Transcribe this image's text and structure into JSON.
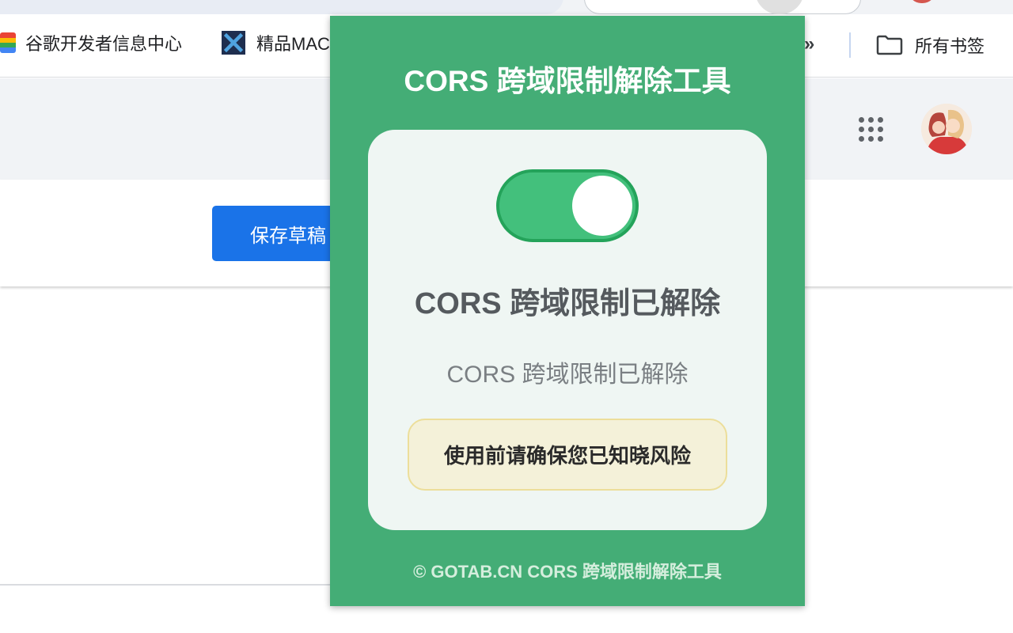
{
  "browser": {
    "bookmarks": [
      {
        "label": "谷歌开发者信息中心",
        "icon": "google-developers-icon"
      },
      {
        "label": "精品MAC",
        "icon": "x-app-icon"
      }
    ],
    "more_label": "»",
    "all_bookmarks_label": "所有书签",
    "apps_icon": "apps-grid-icon",
    "avatar_icon": "profile-avatar"
  },
  "page": {
    "save_draft_label": "保存草稿",
    "primary_color": "#1a73e8"
  },
  "popup": {
    "title": "CORS 跨域限制解除工具",
    "toggle_state": "on",
    "status_title": "CORS 跨域限制已解除",
    "status_subtitle": "CORS 跨域限制已解除",
    "warning": "使用前请确保您已知晓风险",
    "footer": "© GOTAB.CN CORS 跨域限制解除工具",
    "accent_color": "#44ad76"
  }
}
